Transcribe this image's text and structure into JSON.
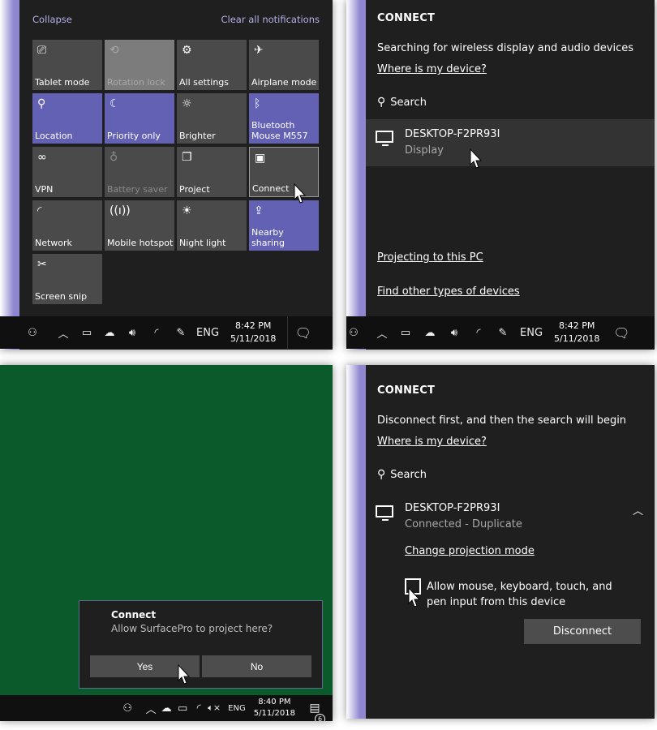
{
  "action_center": {
    "collapse_label": "Collapse",
    "clear_label": "Clear all notifications",
    "tiles": [
      {
        "label": "Tablet mode",
        "icon": "tablet-mode-icon",
        "glyph": "⎚",
        "state": "off"
      },
      {
        "label": "Rotation lock",
        "icon": "rotation-lock-icon",
        "glyph": "⟲",
        "state": "disabled"
      },
      {
        "label": "All settings",
        "icon": "gear-icon",
        "glyph": "⚙",
        "state": "off"
      },
      {
        "label": "Airplane mode",
        "icon": "airplane-icon",
        "glyph": "✈",
        "state": "off"
      },
      {
        "label": "Location",
        "icon": "location-icon",
        "glyph": "⚲",
        "state": "on"
      },
      {
        "label": "Priority only",
        "icon": "moon-icon",
        "glyph": "☾",
        "state": "on"
      },
      {
        "label": "Brighter",
        "icon": "brightness-icon",
        "glyph": "☼",
        "state": "off"
      },
      {
        "label": "Bluetooth\nMouse M557",
        "icon": "bluetooth-icon",
        "glyph": "ᛒ",
        "state": "on"
      },
      {
        "label": "VPN",
        "icon": "vpn-icon",
        "glyph": "∞",
        "state": "off"
      },
      {
        "label": "Battery saver",
        "icon": "battery-saver-icon",
        "glyph": "♁",
        "state": "faded"
      },
      {
        "label": "Project",
        "icon": "project-icon",
        "glyph": "❐",
        "state": "off"
      },
      {
        "label": "Connect",
        "icon": "connect-icon",
        "glyph": "▣",
        "state": "hover"
      },
      {
        "label": "Network",
        "icon": "network-icon",
        "glyph": "◜",
        "state": "off"
      },
      {
        "label": "Mobile hotspot",
        "icon": "hotspot-icon",
        "glyph": "((ı))",
        "state": "off"
      },
      {
        "label": "Night light",
        "icon": "night-light-icon",
        "glyph": "☀",
        "state": "off"
      },
      {
        "label": "Nearby sharing",
        "icon": "nearby-sharing-icon",
        "glyph": "⇪",
        "state": "on"
      },
      {
        "label": "Screen snip",
        "icon": "screen-snip-icon",
        "glyph": "✂",
        "state": "off"
      }
    ]
  },
  "taskbar_top": {
    "time": "8:42 PM",
    "date": "5/11/2018",
    "language": "ENG"
  },
  "connect_search": {
    "title": "CONNECT",
    "status": "Searching for wireless display and audio devices",
    "where_link": "Where is my device?",
    "search_label": "Search",
    "device_name": "DESKTOP-F2PR93I",
    "device_sub": "Display",
    "projecting_link": "Projecting to this PC",
    "find_link": "Find other types of devices"
  },
  "desktop": {
    "toast_title": "Connect",
    "toast_message": "Allow SurfacePro to project here?",
    "yes_label": "Yes",
    "no_label": "No",
    "time": "8:40 PM",
    "date": "5/11/2018",
    "language": "ENG",
    "notification_count": "6"
  },
  "connect_connected": {
    "title": "CONNECT",
    "status": "Disconnect first, and then the search will begin",
    "where_link": "Where is my device?",
    "search_label": "Search",
    "device_name": "DESKTOP-F2PR93I",
    "device_sub": "Connected - Duplicate",
    "change_mode_link": "Change projection mode",
    "allow_input_label_1": "Allow mouse, keyboard, touch, and",
    "allow_input_label_2": "pen input from this device",
    "allow_input_checked": false,
    "disconnect_label": "Disconnect"
  },
  "colors": {
    "accent": "#6361b4",
    "tile_off": "#4a4a4a",
    "panel_bg": "#1f1f1f",
    "taskbar_bg": "#101010",
    "desktop_green": "#0b5a2c"
  }
}
